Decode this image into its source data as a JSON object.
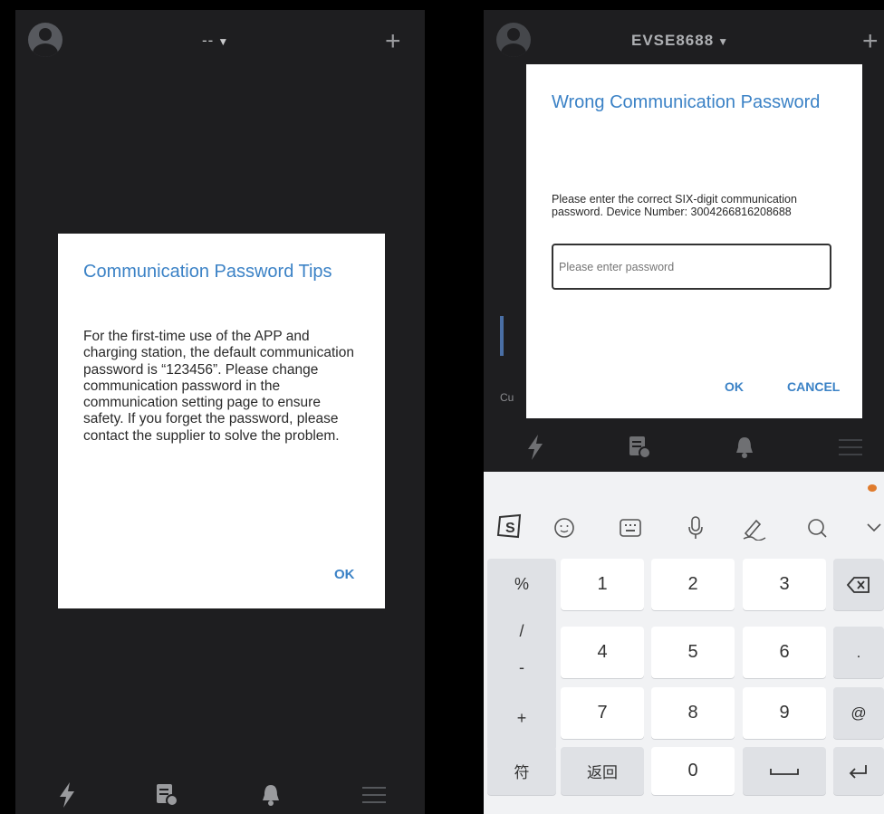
{
  "left_screen": {
    "header": {
      "title": "--",
      "avatar_icon": "user-avatar-icon",
      "add_icon": "plus-icon"
    },
    "dialog": {
      "title": "Communication Password Tips",
      "body": "For the first-time use of the APP and charging station, the default communication password is “123456”. Please change communication password in the communication setting page to ensure safety. If you forget the password, please contact the supplier to solve the problem.",
      "ok_label": "OK"
    },
    "nav": [
      "charge-bolt-icon",
      "records-icon",
      "bell-icon",
      "menu-icon"
    ]
  },
  "right_screen": {
    "header": {
      "title": "EVSE8688",
      "avatar_icon": "user-avatar-icon",
      "add_icon": "plus-icon"
    },
    "background_label": "Cu",
    "dialog": {
      "title": "Wrong Communication Password",
      "body": "Please enter the correct SIX-digit communication password. Device Number: 3004266816208688",
      "input_placeholder": "Please enter password",
      "input_value": "",
      "ok_label": "OK",
      "cancel_label": "CANCEL"
    },
    "nav": [
      "charge-bolt-icon",
      "records-icon",
      "bell-icon",
      "menu-icon"
    ],
    "keyboard": {
      "toolbar_icons": [
        "sogou-logo-icon",
        "emoji-icon",
        "keyboard-icon",
        "microphone-icon",
        "handwriting-icon",
        "search-icon",
        "collapse-icon"
      ],
      "symbols": [
        "%",
        "/",
        "-",
        "+"
      ],
      "digit_rows": [
        [
          "1",
          "2",
          "3"
        ],
        [
          "4",
          "5",
          "6"
        ],
        [
          "7",
          "8",
          "9"
        ]
      ],
      "right_keys": [
        ".",
        "@"
      ],
      "bottom_row": {
        "symbols_key": "符",
        "back_key": "返回",
        "zero_key": "0"
      }
    }
  },
  "colors": {
    "accent": "#3b82c6",
    "app_background": "#1e1e20"
  }
}
